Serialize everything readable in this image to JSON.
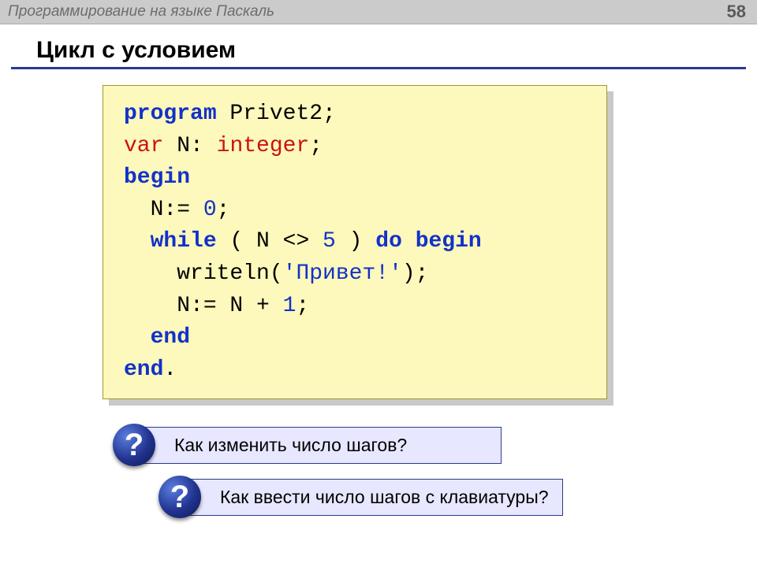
{
  "header": {
    "course": "Программирование на языке Паскаль",
    "page": "58"
  },
  "title": "Цикл с условием",
  "code": {
    "l1_kw": "program",
    "l1_rest": " Privet2;",
    "l2_var": "var",
    "l2_mid": " N: ",
    "l2_type": "integer",
    "l2_end": ";",
    "l3": "begin",
    "l4_a": "  N:= ",
    "l4_num": "0",
    "l4_b": ";",
    "l5_a": "  ",
    "l5_while": "while",
    "l5_b": " ( N <> ",
    "l5_num": "5",
    "l5_c": " ) ",
    "l5_do": "do",
    "l5_sp": " ",
    "l5_begin": "begin",
    "l6_a": "    writeln(",
    "l6_str": "'Привет!'",
    "l6_b": ");",
    "l7_a": "    N:= N + ",
    "l7_num": "1",
    "l7_b": ";",
    "l8_a": "  ",
    "l8_end": "end",
    "l9_end": "end",
    "l9_dot": "."
  },
  "callouts": {
    "q1": {
      "badge": "?",
      "text": "Как изменить число шагов?"
    },
    "q2": {
      "badge": "?",
      "text": "Как ввести число шагов с клавиатуры?"
    }
  }
}
